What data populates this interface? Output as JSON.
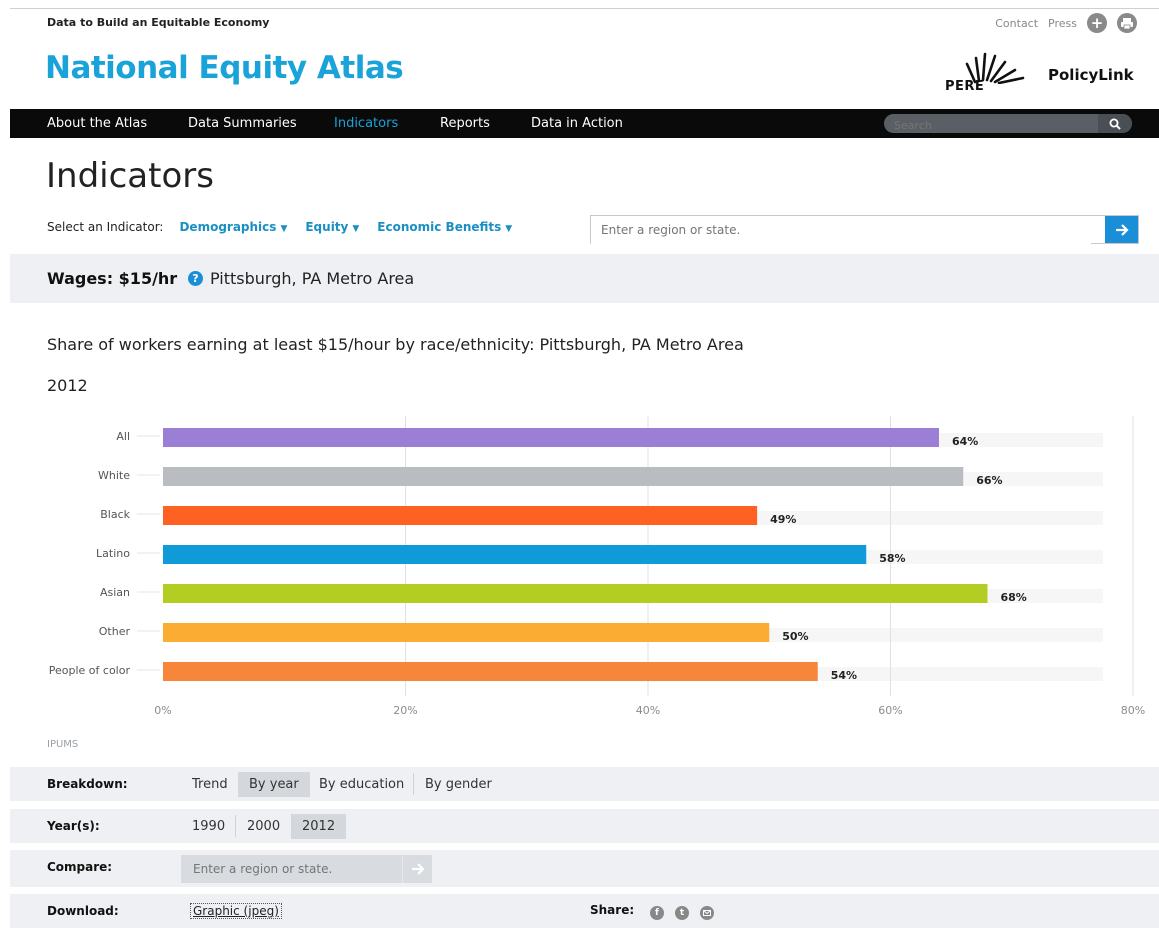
{
  "header": {
    "tagline": "Data to Build an Equitable Economy",
    "contact_label": "Contact",
    "press_label": "Press",
    "logo": "National Equity Atlas",
    "pere_label": "PERE",
    "policylink_label": "PolicyLink"
  },
  "nav": {
    "items": [
      {
        "label": "About the Atlas",
        "active": false
      },
      {
        "label": "Data Summaries",
        "active": false
      },
      {
        "label": "Indicators",
        "active": true
      },
      {
        "label": "Reports",
        "active": false
      },
      {
        "label": "Data in Action",
        "active": false
      }
    ],
    "search_placeholder": "Search"
  },
  "page": {
    "title": "Indicators",
    "select_label": "Select an Indicator:",
    "dropdowns": [
      "Demographics",
      "Equity",
      "Economic Benefits"
    ],
    "region_placeholder": "Enter a region or state."
  },
  "indicator": {
    "name": "Wages: $15/hr",
    "place": "Pittsburgh, PA Metro Area"
  },
  "chart_heading": {
    "title": "Share of workers earning at least $15/hour by race/ethnicity: Pittsburgh, PA Metro Area",
    "year": "2012"
  },
  "chart_data": {
    "type": "bar",
    "orientation": "horizontal",
    "categories": [
      "All",
      "White",
      "Black",
      "Latino",
      "Asian",
      "Other",
      "People of color"
    ],
    "values": [
      64,
      66,
      49,
      58,
      68,
      50,
      54
    ],
    "value_labels": [
      "64%",
      "66%",
      "49%",
      "58%",
      "68%",
      "50%",
      "54%"
    ],
    "colors": [
      "#9b7fd4",
      "#b9bcc1",
      "#ff6122",
      "#0f9bd7",
      "#b3cd22",
      "#fbad33",
      "#f8863a"
    ],
    "xlim": [
      0,
      80
    ],
    "xticks": [
      "0%",
      "20%",
      "40%",
      "60%",
      "80%"
    ],
    "grid": true,
    "unit": "%"
  },
  "source": "IPUMS",
  "controls": {
    "breakdown_label": "Breakdown:",
    "breakdown_options": [
      {
        "label": "Trend",
        "selected": false
      },
      {
        "label": "By year",
        "selected": true
      },
      {
        "label": "By education",
        "selected": false
      },
      {
        "label": "By gender",
        "selected": false
      }
    ],
    "years_label": "Year(s):",
    "year_options": [
      {
        "label": "1990",
        "selected": false
      },
      {
        "label": "2000",
        "selected": false
      },
      {
        "label": "2012",
        "selected": true
      }
    ],
    "compare_label": "Compare:",
    "compare_placeholder": "Enter a region or state.",
    "download_label": "Download:",
    "download_link": "Graphic (jpeg)",
    "share_label": "Share:",
    "share_icons": [
      "facebook-icon",
      "twitter-icon",
      "email-icon"
    ]
  }
}
